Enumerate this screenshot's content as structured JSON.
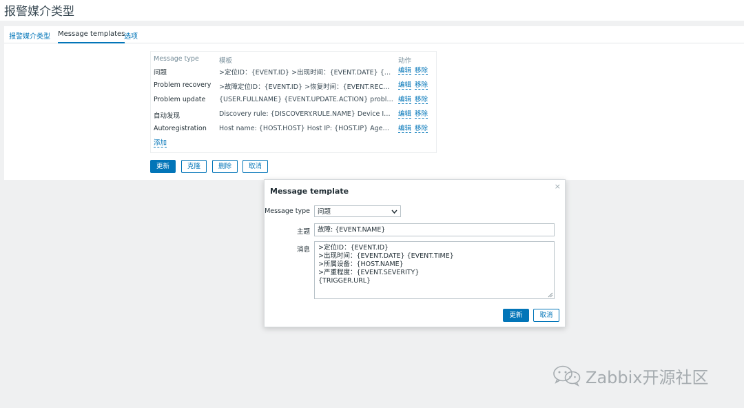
{
  "page": {
    "title": "报警媒介类型"
  },
  "tabs": [
    {
      "label": "报警媒介类型"
    },
    {
      "label": "Message templates"
    },
    {
      "label": "选项"
    }
  ],
  "templates": {
    "headers": {
      "type": "Message type",
      "template": "模板",
      "actions": "动作"
    },
    "rows": [
      {
        "type": "问题",
        "template": ">定位ID：{EVENT.ID} >出现时间：{EVENT.DATE} {EVENT.TIME}",
        "edit": "编辑",
        "remove": "移除"
      },
      {
        "type": "Problem recovery",
        "template": ">故障定位ID：{EVENT.ID} >恢复时间：{EVENT.RECOVERY.DATE}",
        "edit": "编辑",
        "remove": "移除"
      },
      {
        "type": "Problem update",
        "template": "{USER.FULLNAME} {EVENT.UPDATE.ACTION} problem at {EVENT.UPDATE.DATE}",
        "edit": "编辑",
        "remove": "移除"
      },
      {
        "type": "自动发现",
        "template": "Discovery rule: {DISCOVERY.RULE.NAME} Device IP: {DISCOVERY.DEVICE.IPADDRESS}",
        "edit": "编辑",
        "remove": "移除"
      },
      {
        "type": "Autoregistration",
        "template": "Host name: {HOST.HOST} Host IP: {HOST.IP} Agent port: {HOST.PORT}",
        "edit": "编辑",
        "remove": "移除"
      }
    ],
    "add_label": "添加"
  },
  "form_buttons": {
    "update": "更新",
    "clone": "克隆",
    "delete": "删除",
    "cancel": "取消"
  },
  "modal": {
    "title": "Message template",
    "close_icon": "×",
    "message_type_label": "Message type",
    "message_type_value": "问题",
    "subject_label": "主题",
    "subject_value": "故障: {EVENT.NAME}",
    "message_label": "消息",
    "message_lines": [
      ">定位ID：{EVENT.ID}",
      ">出现时间：{EVENT.DATE} {EVENT.TIME}",
      ">所属设备：{HOST.NAME}",
      ">严重程度：{EVENT.SEVERITY}",
      "{TRIGGER.URL}"
    ],
    "update_label": "更新",
    "cancel_label": "取消"
  },
  "watermark": {
    "text": "Zabbix开源社区",
    "icon": "wechat-icon"
  },
  "colors": {
    "accent": "#0275b8",
    "text": "#1f2c33",
    "muted": "#768d99",
    "background": "#f0f1f2"
  }
}
